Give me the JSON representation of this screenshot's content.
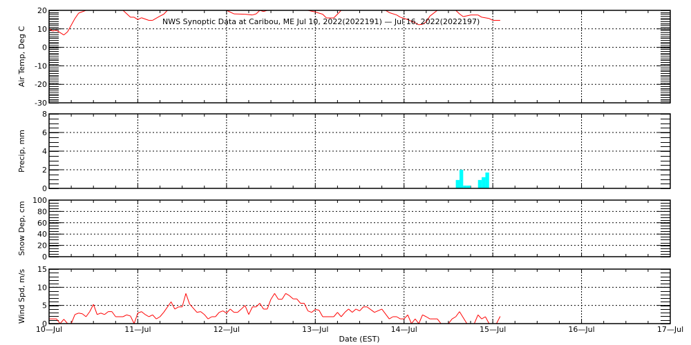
{
  "chart_data": [
    {
      "type": "line",
      "title": "NWS Synoptic Data at Caribou, ME   Jul 10, 2022(2022191) — Jul 16, 2022(2022197)",
      "ylabel": "Air Temp, Deg C",
      "ylim": [
        -30,
        20
      ],
      "yticks": [
        20,
        10,
        0,
        -10,
        -20,
        -30
      ],
      "minor_step": 1,
      "color": "#ff0000",
      "x_unit": "hours since 10-Jul 00:00",
      "points": [
        [
          0,
          10
        ],
        [
          1,
          8.8
        ],
        [
          2,
          9.2
        ],
        [
          4,
          6.7
        ],
        [
          5,
          8.4
        ],
        [
          7,
          15.6
        ],
        [
          8,
          18.5
        ],
        [
          10,
          20
        ],
        [
          16,
          24
        ],
        [
          20,
          20
        ],
        [
          22,
          16.3
        ],
        [
          23,
          16.3
        ],
        [
          24,
          15
        ],
        [
          25,
          16
        ],
        [
          27,
          14.6
        ],
        [
          28,
          14.6
        ],
        [
          30,
          16.9
        ],
        [
          31,
          17.9
        ],
        [
          32,
          20
        ],
        [
          40,
          25
        ],
        [
          48,
          20
        ],
        [
          50,
          18.1
        ],
        [
          53,
          17.9
        ],
        [
          55,
          17.5
        ],
        [
          56,
          18.1
        ],
        [
          57,
          20
        ],
        [
          58,
          19.4
        ],
        [
          59,
          20
        ],
        [
          66,
          25
        ],
        [
          70,
          20
        ],
        [
          72,
          19.1
        ],
        [
          74,
          17.9
        ],
        [
          75,
          15.9
        ],
        [
          77,
          15.9
        ],
        [
          79,
          20
        ],
        [
          86,
          24
        ],
        [
          91,
          20
        ],
        [
          92,
          18.8
        ],
        [
          94,
          17.5
        ],
        [
          95,
          16.3
        ],
        [
          97,
          15
        ],
        [
          99,
          13.2
        ],
        [
          100,
          12.2
        ],
        [
          101,
          12.5
        ],
        [
          102,
          13.8
        ],
        [
          103,
          16.9
        ],
        [
          105,
          20
        ],
        [
          108,
          22
        ],
        [
          110,
          20
        ],
        [
          111,
          18.1
        ],
        [
          112,
          16.6
        ],
        [
          114,
          17.5
        ],
        [
          116,
          17.5
        ],
        [
          117,
          16.3
        ],
        [
          119,
          15.6
        ],
        [
          120,
          14.6
        ],
        [
          122,
          14.6
        ]
      ]
    },
    {
      "type": "bar",
      "ylabel": "Precip, mm",
      "ylim": [
        0,
        8
      ],
      "yticks": [
        8,
        6,
        4,
        2,
        0
      ],
      "minor_step": 0.5,
      "color": "#00ffff",
      "x_unit": "hours since 10-Jul 00:00",
      "points": [
        [
          110,
          0.9
        ],
        [
          111,
          2.0
        ],
        [
          112,
          0.3
        ],
        [
          113,
          0.3
        ],
        [
          116,
          0.9
        ],
        [
          117,
          1.2
        ],
        [
          118,
          1.7
        ]
      ]
    },
    {
      "type": "line",
      "ylabel": "Snow Dep, cm",
      "ylim": [
        0,
        100
      ],
      "yticks": [
        100,
        80,
        60,
        40,
        20,
        0
      ],
      "minor_step": 5,
      "color": "#ff0000",
      "points": []
    },
    {
      "type": "line",
      "ylabel": "Wind Spd, m/s",
      "xlabel": "Date (EST)",
      "ylim": [
        0,
        15
      ],
      "yticks": [
        15,
        10,
        5,
        0
      ],
      "minor_step": 1,
      "color": "#ff0000",
      "x_unit": "hours since 10-Jul 00:00",
      "points": [
        [
          0,
          1.3
        ],
        [
          2,
          1.3
        ],
        [
          3,
          0
        ],
        [
          4,
          1.2
        ],
        [
          5,
          0
        ],
        [
          6,
          0
        ],
        [
          7,
          2.5
        ],
        [
          8,
          2.9
        ],
        [
          9,
          2.7
        ],
        [
          10,
          1.9
        ],
        [
          11,
          3.3
        ],
        [
          12,
          5.3
        ],
        [
          13,
          2.5
        ],
        [
          14,
          2.9
        ],
        [
          15,
          2.5
        ],
        [
          16,
          3.3
        ],
        [
          17,
          3.3
        ],
        [
          18,
          1.9
        ],
        [
          20,
          1.9
        ],
        [
          21,
          2.4
        ],
        [
          22,
          2.1
        ],
        [
          23,
          0
        ],
        [
          24,
          2.9
        ],
        [
          25,
          3.3
        ],
        [
          26,
          2.5
        ],
        [
          27,
          1.9
        ],
        [
          28,
          2.4
        ],
        [
          29,
          1.3
        ],
        [
          30,
          1.9
        ],
        [
          31,
          3.1
        ],
        [
          33,
          6.0
        ],
        [
          34,
          4.0
        ],
        [
          35,
          4.6
        ],
        [
          36,
          4.6
        ],
        [
          37,
          8.3
        ],
        [
          38,
          5.4
        ],
        [
          40,
          3.1
        ],
        [
          41,
          3.3
        ],
        [
          42,
          2.5
        ],
        [
          43,
          1.3
        ],
        [
          44,
          1.9
        ],
        [
          45,
          1.9
        ],
        [
          46,
          3.1
        ],
        [
          47,
          3.5
        ],
        [
          48,
          2.9
        ],
        [
          49,
          4.0
        ],
        [
          50,
          3.1
        ],
        [
          51,
          3.1
        ],
        [
          52,
          4.0
        ],
        [
          53,
          5.0
        ],
        [
          54,
          2.5
        ],
        [
          55,
          4.6
        ],
        [
          56,
          4.6
        ],
        [
          57,
          5.6
        ],
        [
          58,
          4.0
        ],
        [
          59,
          4.0
        ],
        [
          60,
          6.7
        ],
        [
          61,
          8.3
        ],
        [
          62,
          6.7
        ],
        [
          63,
          6.7
        ],
        [
          64,
          8.3
        ],
        [
          65,
          7.7
        ],
        [
          66,
          6.8
        ],
        [
          67,
          6.8
        ],
        [
          68,
          5.6
        ],
        [
          69,
          5.6
        ],
        [
          70,
          3.5
        ],
        [
          71,
          3.1
        ],
        [
          72,
          3.9
        ],
        [
          73,
          3.7
        ],
        [
          74,
          1.9
        ],
        [
          77,
          1.9
        ],
        [
          78,
          3.1
        ],
        [
          79,
          1.9
        ],
        [
          80,
          3.1
        ],
        [
          81,
          4.0
        ],
        [
          82,
          3.1
        ],
        [
          83,
          4.0
        ],
        [
          84,
          3.5
        ],
        [
          85,
          4.6
        ],
        [
          86,
          4.6
        ],
        [
          88,
          3.1
        ],
        [
          90,
          4.0
        ],
        [
          92,
          1.3
        ],
        [
          93,
          1.9
        ],
        [
          94,
          1.9
        ],
        [
          95,
          1.3
        ],
        [
          96,
          1.3
        ],
        [
          97,
          2.4
        ],
        [
          98,
          0
        ],
        [
          99,
          1.3
        ],
        [
          100,
          0
        ],
        [
          101,
          2.4
        ],
        [
          102,
          1.9
        ],
        [
          103,
          1.3
        ],
        [
          105,
          1.3
        ],
        [
          106,
          0
        ],
        [
          108,
          0
        ],
        [
          109,
          1.3
        ],
        [
          110,
          1.9
        ],
        [
          111,
          3.3
        ],
        [
          113,
          0
        ],
        [
          115,
          0
        ],
        [
          116,
          2.4
        ],
        [
          117,
          1.3
        ],
        [
          118,
          1.9
        ],
        [
          119,
          0
        ],
        [
          121,
          0
        ],
        [
          122,
          2.0
        ]
      ]
    }
  ],
  "x_axis": {
    "tick_labels": [
      "10—Jul",
      "11—Jul",
      "12—Jul",
      "13—Jul",
      "14—Jul",
      "15—Jul",
      "16—Jul",
      "17—Jul"
    ],
    "range_hours": [
      0,
      168
    ],
    "label": "Date (EST)"
  }
}
